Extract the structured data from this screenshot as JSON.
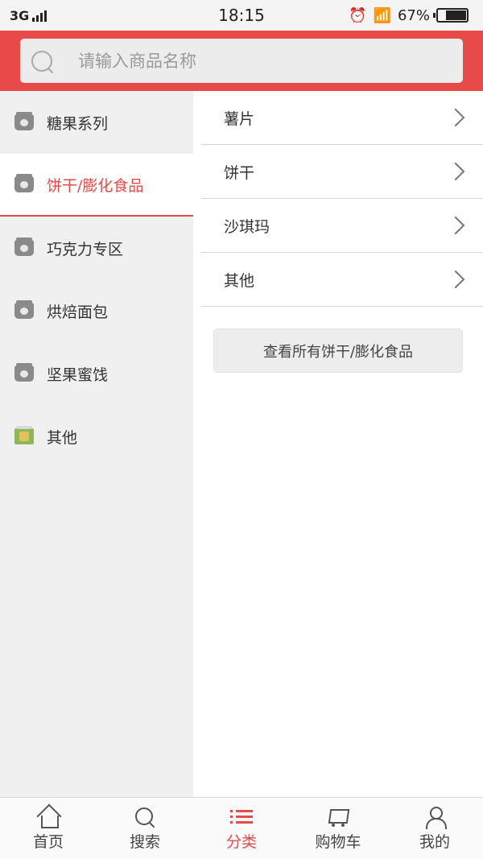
{
  "status_bar": {
    "network": "3G",
    "time": "18:15",
    "battery": "67%",
    "icons": [
      "signal-icon",
      "alarm-icon",
      "wifi-icon",
      "battery-icon"
    ]
  },
  "search": {
    "placeholder": "请输入商品名称",
    "icon": "search-icon"
  },
  "sidebar": {
    "items": [
      {
        "label": "糖果系列",
        "icon": "category-icon"
      },
      {
        "label": "饼干/膨化食品",
        "icon": "category-icon"
      },
      {
        "label": "巧克力专区",
        "icon": "category-icon"
      },
      {
        "label": "烘焙面包",
        "icon": "category-icon"
      },
      {
        "label": "坚果蜜饯",
        "icon": "category-icon"
      },
      {
        "label": "其他",
        "icon": "product-photo-icon"
      }
    ],
    "active_index": 1
  },
  "subcategories": {
    "items": [
      {
        "label": "薯片"
      },
      {
        "label": "饼干"
      },
      {
        "label": "沙琪玛"
      },
      {
        "label": "其他"
      }
    ],
    "view_all_label": "查看所有饼干/膨化食品"
  },
  "bottom_nav": {
    "items": [
      {
        "label": "首页",
        "icon": "home-icon"
      },
      {
        "label": "搜索",
        "icon": "search-icon"
      },
      {
        "label": "分类",
        "icon": "list-icon"
      },
      {
        "label": "购物车",
        "icon": "cart-icon"
      },
      {
        "label": "我的",
        "icon": "user-icon"
      }
    ],
    "active_index": 2
  },
  "colors": {
    "accent": "#e84a4a",
    "sidebar_bg": "#f0f0f0",
    "text": "#333333"
  }
}
